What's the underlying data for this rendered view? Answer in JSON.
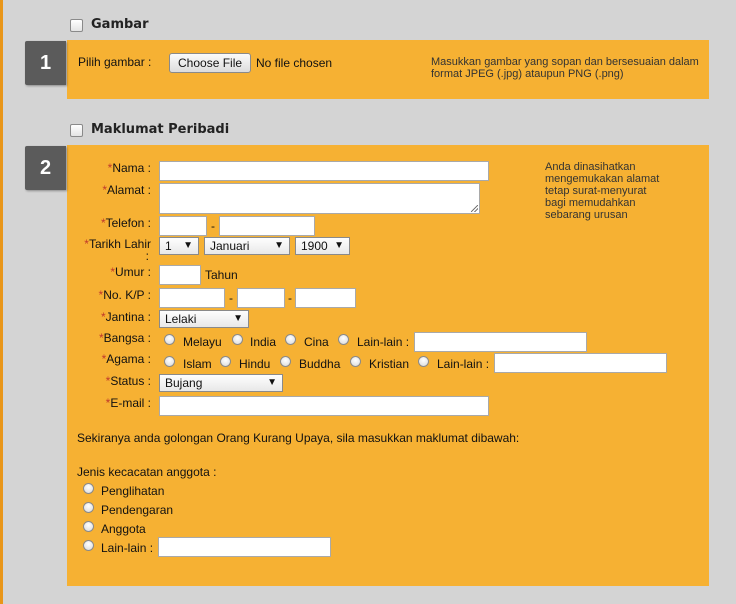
{
  "sections": {
    "gambar": {
      "number": "1",
      "title": "Gambar",
      "pick_label": "Pilih gambar :",
      "file_button": "Choose File",
      "file_status": "No file chosen",
      "note_line1": "Masukkan gambar yang sopan dan bersesuaian dalam",
      "note_line2": "format JPEG (.jpg) ataupun PNG (.png)"
    },
    "peribadi": {
      "number": "2",
      "title": "Maklumat Peribadi",
      "required_mark": "*",
      "note_lines": [
        "Anda dinasihatkan",
        "mengemukakan alamat",
        "tetap surat-menyurat",
        "bagi memudahkan",
        "sebarang urusan"
      ],
      "labels": {
        "nama": "Nama :",
        "alamat": "Alamat :",
        "telefon": "Telefon :",
        "tarikh_lahir_1": "Tarikh Lahir",
        "tarikh_lahir_2": ":",
        "umur": "Umur :",
        "no_kp": "No. K/P :",
        "jantina": "Jantina :",
        "bangsa": "Bangsa :",
        "agama": "Agama :",
        "status": "Status :",
        "email": "E-mail :"
      },
      "dash": "-",
      "tahun": "Tahun",
      "selects": {
        "day": "1",
        "month": "Januari",
        "year": "1900",
        "jantina": "Lelaki",
        "status": "Bujang"
      },
      "bangsa_options": [
        "Melayu",
        "India",
        "Cina",
        "Lain-lain :"
      ],
      "agama_options": [
        "Islam",
        "Hindu",
        "Buddha",
        "Kristian",
        "Lain-lain :"
      ],
      "oku_text": "Sekiranya anda golongan Orang Kurang Upaya, sila masukkan maklumat dibawah:",
      "kecacatan_label": "Jenis kecacatan anggota :",
      "kecacatan_options": [
        "Penglihatan",
        "Pendengaran",
        "Anggota",
        "Lain-lain :"
      ]
    }
  },
  "colors": {
    "panel": "#f6b133",
    "badge": "#5b5b5b",
    "required": "#c0392b",
    "background": "#d4d4d4"
  }
}
